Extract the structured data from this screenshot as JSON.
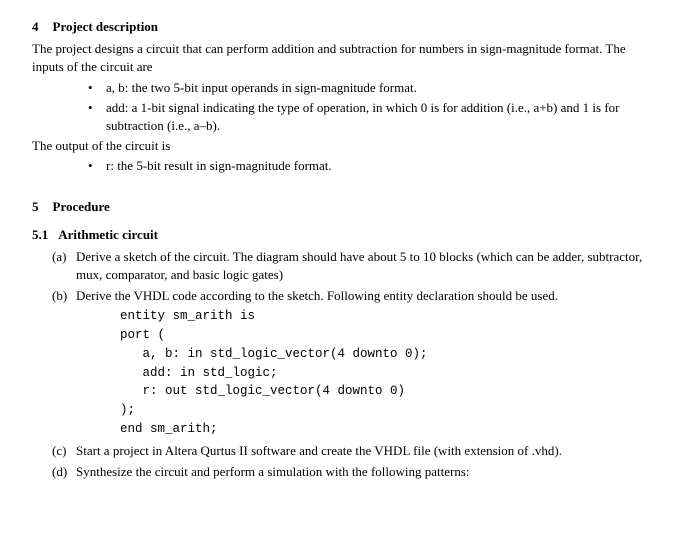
{
  "section4": {
    "number": "4",
    "title": "Project description",
    "intro1": "The project designs a circuit that can perform addition and subtraction for numbers in sign-magnitude format.  The inputs of the circuit are",
    "bullets_in": [
      "a, b: the two 5-bit input operands in sign-magnitude format.",
      "add: a 1-bit signal indicating the type of operation, in which 0 is for addition (i.e., a+b) and 1 is for subtraction (i.e., a–b)."
    ],
    "intro2": "The output of the circuit is",
    "bullets_out": [
      "r: the 5-bit result in sign-magnitude format."
    ]
  },
  "section5": {
    "number": "5",
    "title": "Procedure",
    "sub1": {
      "number": "5.1",
      "title": "Arithmetic circuit",
      "items": [
        {
          "marker": "(a)",
          "text": "Derive a sketch of the circuit.   The diagram should have about 5 to 10 blocks (which can be adder, subtractor, mux, comparator, and basic logic gates)"
        },
        {
          "marker": "(b)",
          "text": "Derive the VHDL code according to the sketch.  Following entity declaration should be used.",
          "code": "entity sm_arith is\nport (\n   a, b: in std_logic_vector(4 downto 0);\n   add: in std_logic;\n   r: out std_logic_vector(4 downto 0)\n);\nend sm_arith;"
        },
        {
          "marker": "(c)",
          "text": "Start a project in Altera Qurtus II software and create the VHDL file (with extension of .vhd)."
        },
        {
          "marker": "(d)",
          "text": "Synthesize the circuit and perform a simulation with the following patterns:"
        }
      ]
    }
  }
}
